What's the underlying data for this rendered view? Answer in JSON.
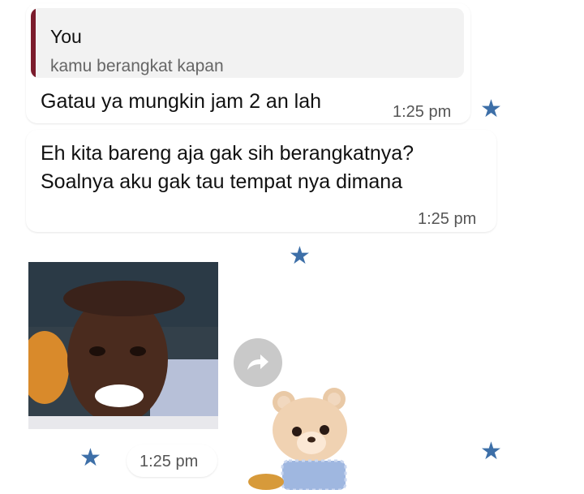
{
  "messages": [
    {
      "quote": {
        "author": "You",
        "text": "kamu berangkat kapan"
      },
      "text": "Gatau ya mungkin jam 2 an lah",
      "time": "1:25 pm",
      "starred": true
    },
    {
      "text": "Eh kita bareng aja gak sih berangkatnya?\nSoalnya aku gak tau tempat nya dimana",
      "time": "1:25 pm",
      "starred": true
    },
    {
      "type": "image",
      "time": "1:25 pm",
      "starred": true
    },
    {
      "type": "sticker",
      "starred": true
    }
  ],
  "icons": {
    "star": "star-icon",
    "forward": "forward-icon"
  },
  "colors": {
    "quote_bar": "#7b1c2c",
    "star": "#3d6fa8",
    "forward_button": "#c9c9c9"
  }
}
